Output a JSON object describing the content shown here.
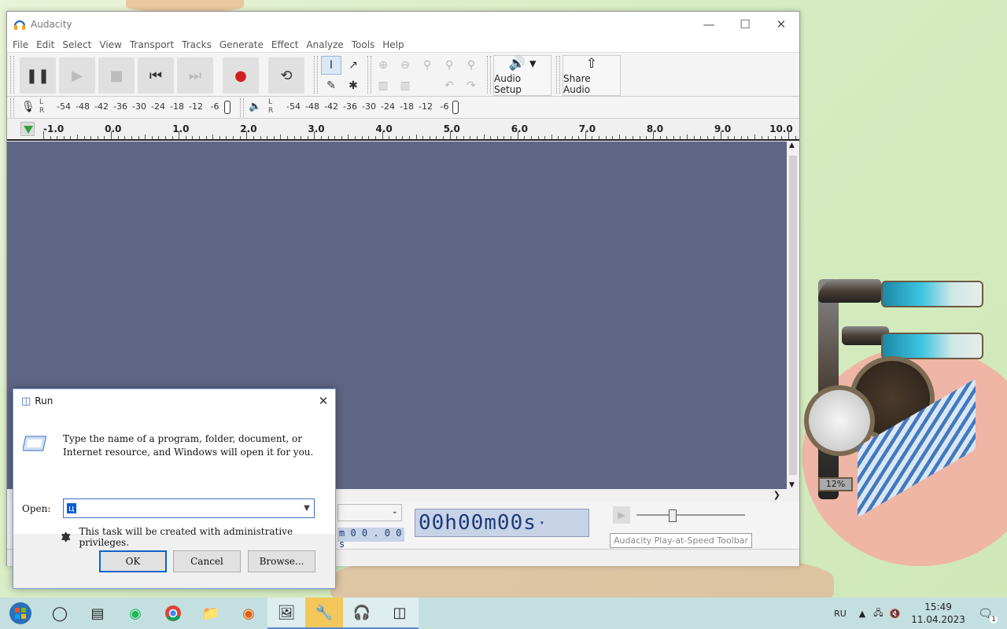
{
  "window": {
    "title": "Audacity",
    "menu": [
      "File",
      "Edit",
      "Select",
      "View",
      "Transport",
      "Tracks",
      "Generate",
      "Effect",
      "Analyze",
      "Tools",
      "Help"
    ]
  },
  "toolbar": {
    "audio_setup": "Audio Setup",
    "share_audio": "Share Audio"
  },
  "meters": {
    "rec_scale": [
      "-54",
      "-48",
      "-42",
      "-36",
      "-30",
      "-24",
      "-18",
      "-12",
      "-6"
    ],
    "play_scale": [
      "-54",
      "-48",
      "-42",
      "-36",
      "-30",
      "-24",
      "-18",
      "-12",
      "-6"
    ],
    "l": "L",
    "r": "R"
  },
  "ruler": {
    "labels": [
      "-1.0",
      "0.0",
      "1.0",
      "2.0",
      "3.0",
      "4.0",
      "5.0",
      "6.0",
      "7.0",
      "8.0",
      "9.0",
      "10.0"
    ]
  },
  "bottom": {
    "time": "00h00m00s",
    "small_time": "m 0 0 . 0 0 s",
    "tooltip": "Audacity Play-at-Speed Toolbar"
  },
  "run_dialog": {
    "title": "Run",
    "description": "Type the name of a program, folder, document, or Internet resource, and Windows will open it for you.",
    "open_label": "Open:",
    "open_value": "ц",
    "admin_note": "This task will be created with administrative privileges.",
    "ok": "OK",
    "cancel": "Cancel",
    "browse": "Browse..."
  },
  "gadget": {
    "percent": "12%"
  },
  "taskbar": {
    "lang": "RU",
    "time": "15:49",
    "date": "11.04.2023",
    "notif_count": "1"
  }
}
